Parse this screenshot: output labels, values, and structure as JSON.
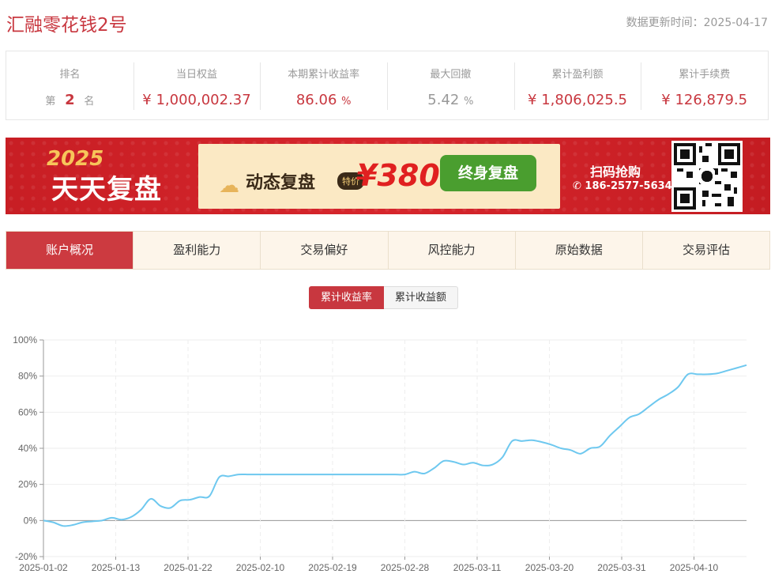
{
  "header": {
    "title": "汇融零花钱2号",
    "update": "数据更新时间：2025-04-17"
  },
  "stats": [
    {
      "label": "排名",
      "pre": "第",
      "value": "2",
      "post": "名",
      "kind": "rank"
    },
    {
      "label": "当日权益",
      "value": "¥ 1,000,002.37",
      "unit": "",
      "kind": "money"
    },
    {
      "label": "本期累计收益率",
      "value": "86.06",
      "unit": "%",
      "kind": "pct"
    },
    {
      "label": "最大回撤",
      "value": "5.42",
      "unit": "%",
      "kind": "gray"
    },
    {
      "label": "累计盈利额",
      "value": "¥ 1,806,025.5",
      "unit": "",
      "kind": "money"
    },
    {
      "label": "累计手续费",
      "value": "¥ 126,879.5",
      "unit": "",
      "kind": "money"
    }
  ],
  "banner": {
    "year": "2025",
    "slogan": "天天复盘",
    "dynamic": "动态复盘",
    "special": "特价",
    "price": "¥3800",
    "lifetime": "终身复盘",
    "scan": "扫码抢购",
    "phone": "186-2577-5634"
  },
  "tabs": [
    "账户概况",
    "盈利能力",
    "交易偏好",
    "风控能力",
    "原始数据",
    "交易评估"
  ],
  "active_tab": 0,
  "toggle": {
    "on": "累计收益率",
    "off": "累计收益额"
  },
  "colors": {
    "accent": "#c8373f",
    "line": "#6ec8ef"
  },
  "chart_data": {
    "type": "line",
    "ylim": [
      -20,
      100
    ],
    "yticks": [
      "100%",
      "80%",
      "60%",
      "40%",
      "20%",
      "0%",
      "-20%"
    ],
    "x_labels": [
      "2025-01-02",
      "2025-01-13",
      "2025-01-22",
      "2025-02-10",
      "2025-02-19",
      "2025-02-28",
      "2025-03-11",
      "2025-03-20",
      "2025-03-31",
      "2025-04-10"
    ],
    "series": [
      {
        "values": [
          0,
          -1,
          -3,
          -2.5,
          -1,
          -0.5,
          0,
          1.5,
          0.5,
          2,
          6,
          12,
          8,
          7,
          11,
          11.5,
          13,
          13.5,
          24,
          24.5,
          25.5,
          25.5,
          25.5,
          25.5,
          25.5,
          25.5,
          25.5,
          25.5,
          25.5,
          25.5,
          25.5,
          25.5,
          25.5,
          25.5,
          25.5,
          25.5,
          25.5,
          25.5,
          27,
          26,
          29,
          33,
          32.5,
          31,
          32,
          30.5,
          31,
          35,
          44,
          44,
          44.5,
          43.5,
          42,
          40,
          39,
          37,
          40,
          41,
          47,
          52,
          57,
          59,
          63,
          67,
          70,
          74,
          81,
          81,
          81,
          81.5,
          83,
          84.5,
          86.06
        ]
      }
    ]
  }
}
